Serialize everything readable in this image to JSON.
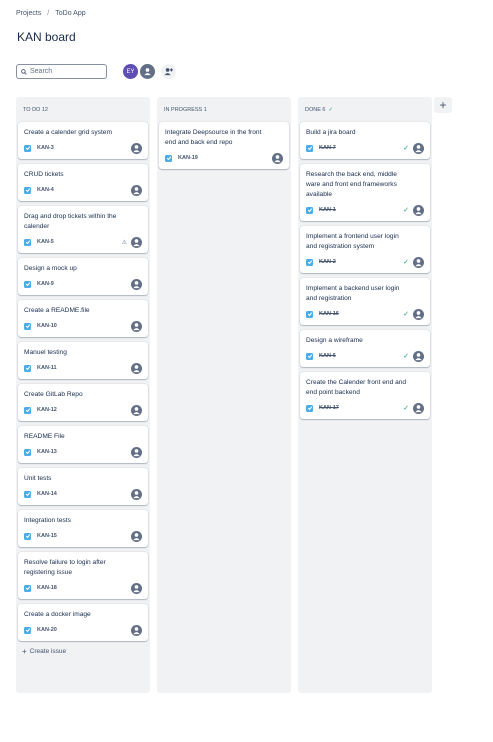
{
  "breadcrumb": {
    "projects": "Projects",
    "separator": "/",
    "app": "ToDo App"
  },
  "page_title": "KAN board",
  "search": {
    "placeholder": "Search"
  },
  "avatars": [
    {
      "initials": "EY"
    }
  ],
  "columns": [
    {
      "title": "TO DO 12",
      "cards": [
        {
          "title": "Create a calender grid system",
          "key": "KAN-3"
        },
        {
          "title": "CRUD tickets",
          "key": "KAN-4"
        },
        {
          "title": "Drag and drop tickets within the calender",
          "key": "KAN-5",
          "icon": "warning-icon"
        },
        {
          "title": "Design a mock up",
          "key": "KAN-9"
        },
        {
          "title": "Create a README.file",
          "key": "KAN-10"
        },
        {
          "title": "Manuel testing",
          "key": "KAN-11"
        },
        {
          "title": "Create GitLab Repo",
          "key": "KAN-12"
        },
        {
          "title": "README File",
          "key": "KAN-13"
        },
        {
          "title": "Unit tests",
          "key": "KAN-14"
        },
        {
          "title": "Integration tests",
          "key": "KAN-15"
        },
        {
          "title": "Resolve failure to login after registering issue",
          "key": "KAN-18"
        },
        {
          "title": "Create a docker image",
          "key": "KAN-20"
        }
      ],
      "create_label": "Create issue"
    },
    {
      "title": "IN PROGRESS 1",
      "cards": [
        {
          "title": "Integrate Deepsource in the front end and back end repo",
          "key": "KAN-19"
        }
      ]
    },
    {
      "title": "DONE 6",
      "cards": [
        {
          "title": "Build a jira board",
          "key": "KAN-7"
        },
        {
          "title": "Research the back end, middle ware and front end frameworks available",
          "key": "KAN-1"
        },
        {
          "title": "Implement a frontend user login and registration system",
          "key": "KAN-2"
        },
        {
          "title": "Implement a backend user login and registration",
          "key": "KAN-16"
        },
        {
          "title": "Design a wireframe",
          "key": "KAN-6"
        },
        {
          "title": "Create the Calender front end and end point backend",
          "key": "KAN-17"
        }
      ]
    }
  ],
  "colors": {
    "accent": "#5e4db2",
    "checkbox": "#4bade8",
    "done": "#22a06b",
    "column_bg": "#f1f2f4"
  }
}
